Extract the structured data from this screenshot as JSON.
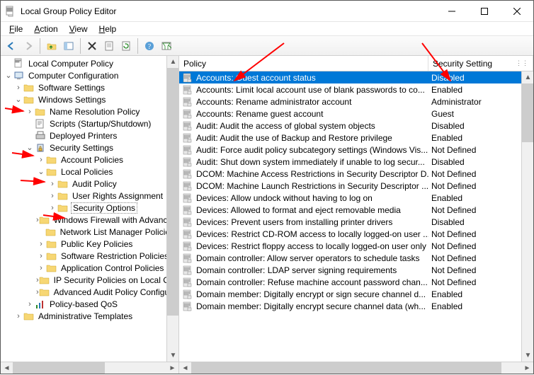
{
  "window": {
    "title": "Local Group Policy Editor"
  },
  "menu": {
    "file": "File",
    "action": "Action",
    "view": "View",
    "help": "Help"
  },
  "columns": {
    "policy": "Policy",
    "setting": "Security Setting"
  },
  "tree": {
    "root": "Local Computer Policy",
    "computer_config": "Computer Configuration",
    "software_settings": "Software Settings",
    "windows_settings": "Windows Settings",
    "name_resolution": "Name Resolution Policy",
    "scripts": "Scripts (Startup/Shutdown)",
    "deployed_printers": "Deployed Printers",
    "security_settings": "Security Settings",
    "account_policies": "Account Policies",
    "local_policies": "Local Policies",
    "audit_policy": "Audit Policy",
    "user_rights": "User Rights Assignment",
    "security_options": "Security Options",
    "windows_firewall": "Windows Firewall with Advanced Security",
    "network_list": "Network List Manager Policies",
    "public_key": "Public Key Policies",
    "software_restriction": "Software Restriction Policies",
    "app_control": "Application Control Policies",
    "ip_security": "IP Security Policies on Local Computer",
    "advanced_audit": "Advanced Audit Policy Configuration",
    "policy_qos": "Policy-based QoS",
    "admin_templates": "Administrative Templates"
  },
  "policies": [
    {
      "name": "Accounts: Guest account status",
      "setting": "Disabled",
      "selected": true
    },
    {
      "name": "Accounts: Limit local account use of blank passwords to co...",
      "setting": "Enabled"
    },
    {
      "name": "Accounts: Rename administrator account",
      "setting": "Administrator"
    },
    {
      "name": "Accounts: Rename guest account",
      "setting": "Guest"
    },
    {
      "name": "Audit: Audit the access of global system objects",
      "setting": "Disabled"
    },
    {
      "name": "Audit: Audit the use of Backup and Restore privilege",
      "setting": "Enabled"
    },
    {
      "name": "Audit: Force audit policy subcategory settings (Windows Vis...",
      "setting": "Not Defined"
    },
    {
      "name": "Audit: Shut down system immediately if unable to log secur...",
      "setting": "Disabled"
    },
    {
      "name": "DCOM: Machine Access Restrictions in Security Descriptor D...",
      "setting": "Not Defined"
    },
    {
      "name": "DCOM: Machine Launch Restrictions in Security Descriptor ...",
      "setting": "Not Defined"
    },
    {
      "name": "Devices: Allow undock without having to log on",
      "setting": "Enabled"
    },
    {
      "name": "Devices: Allowed to format and eject removable media",
      "setting": "Not Defined"
    },
    {
      "name": "Devices: Prevent users from installing printer drivers",
      "setting": "Disabled"
    },
    {
      "name": "Devices: Restrict CD-ROM access to locally logged-on user ...",
      "setting": "Not Defined"
    },
    {
      "name": "Devices: Restrict floppy access to locally logged-on user only",
      "setting": "Not Defined"
    },
    {
      "name": "Domain controller: Allow server operators to schedule tasks",
      "setting": "Not Defined"
    },
    {
      "name": "Domain controller: LDAP server signing requirements",
      "setting": "Not Defined"
    },
    {
      "name": "Domain controller: Refuse machine account password chan...",
      "setting": "Not Defined"
    },
    {
      "name": "Domain member: Digitally encrypt or sign secure channel d...",
      "setting": "Enabled"
    },
    {
      "name": "Domain member: Digitally encrypt secure channel data (wh...",
      "setting": "Enabled"
    }
  ]
}
